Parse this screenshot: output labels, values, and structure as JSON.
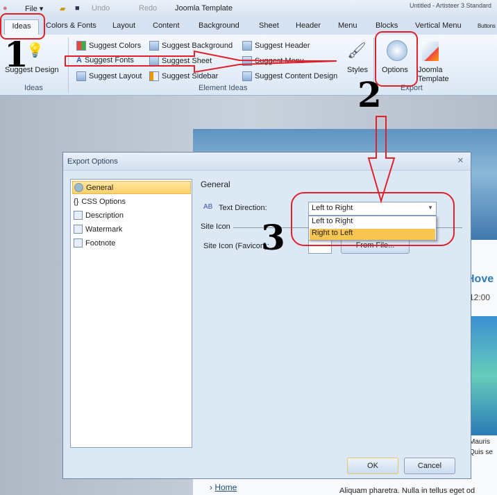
{
  "titlebar": {
    "file": "File",
    "undo": "Undo",
    "redo": "Redo",
    "joomla": "Joomla Template",
    "title": "Untitled - Artisteer 3 Standard"
  },
  "tabs": [
    "Ideas",
    "Colors & Fonts",
    "Layout",
    "Content",
    "Background",
    "Sheet",
    "Header",
    "Menu",
    "Blocks",
    "Vertical Menu",
    "Buttons"
  ],
  "ribbon": {
    "suggest_design": "Suggest Design",
    "ideas_group": "Ideas",
    "items": [
      "Suggest Colors",
      "Suggest Fonts",
      "Suggest Layout",
      "Suggest Background",
      "Suggest Sheet",
      "Suggest Sidebar",
      "Suggest Header",
      "Suggest Menu",
      "Suggest Content Design"
    ],
    "element_ideas_group": "Element Ideas",
    "styles": "Styles",
    "options": "Options",
    "joomla_template": "Joomla Template",
    "export_group": "Export"
  },
  "preview": {
    "heading": "Hove",
    "time": "12:00",
    "text1": "Mauris",
    "text2": "Quis se",
    "text3": "Aliquam pharetra. Nulla in tellus eget od",
    "home_link": "Home"
  },
  "dialog": {
    "title": "Export Options",
    "close": "×",
    "tree": [
      "General",
      "CSS Options",
      "Description",
      "Watermark",
      "Footnote"
    ],
    "section": "General",
    "text_direction_label": "Text Direction:",
    "text_direction_value": "Left to Right",
    "options": [
      "Left to Right",
      "Right to Left"
    ],
    "site_icon_section": "Site Icon",
    "favicon_label": "Site Icon (Favicon):",
    "from_file": "From File...",
    "ok": "OK",
    "cancel": "Cancel"
  },
  "annotations": {
    "n1": "1",
    "n2": "2",
    "n3": "3",
    "color": "#e0202a"
  }
}
